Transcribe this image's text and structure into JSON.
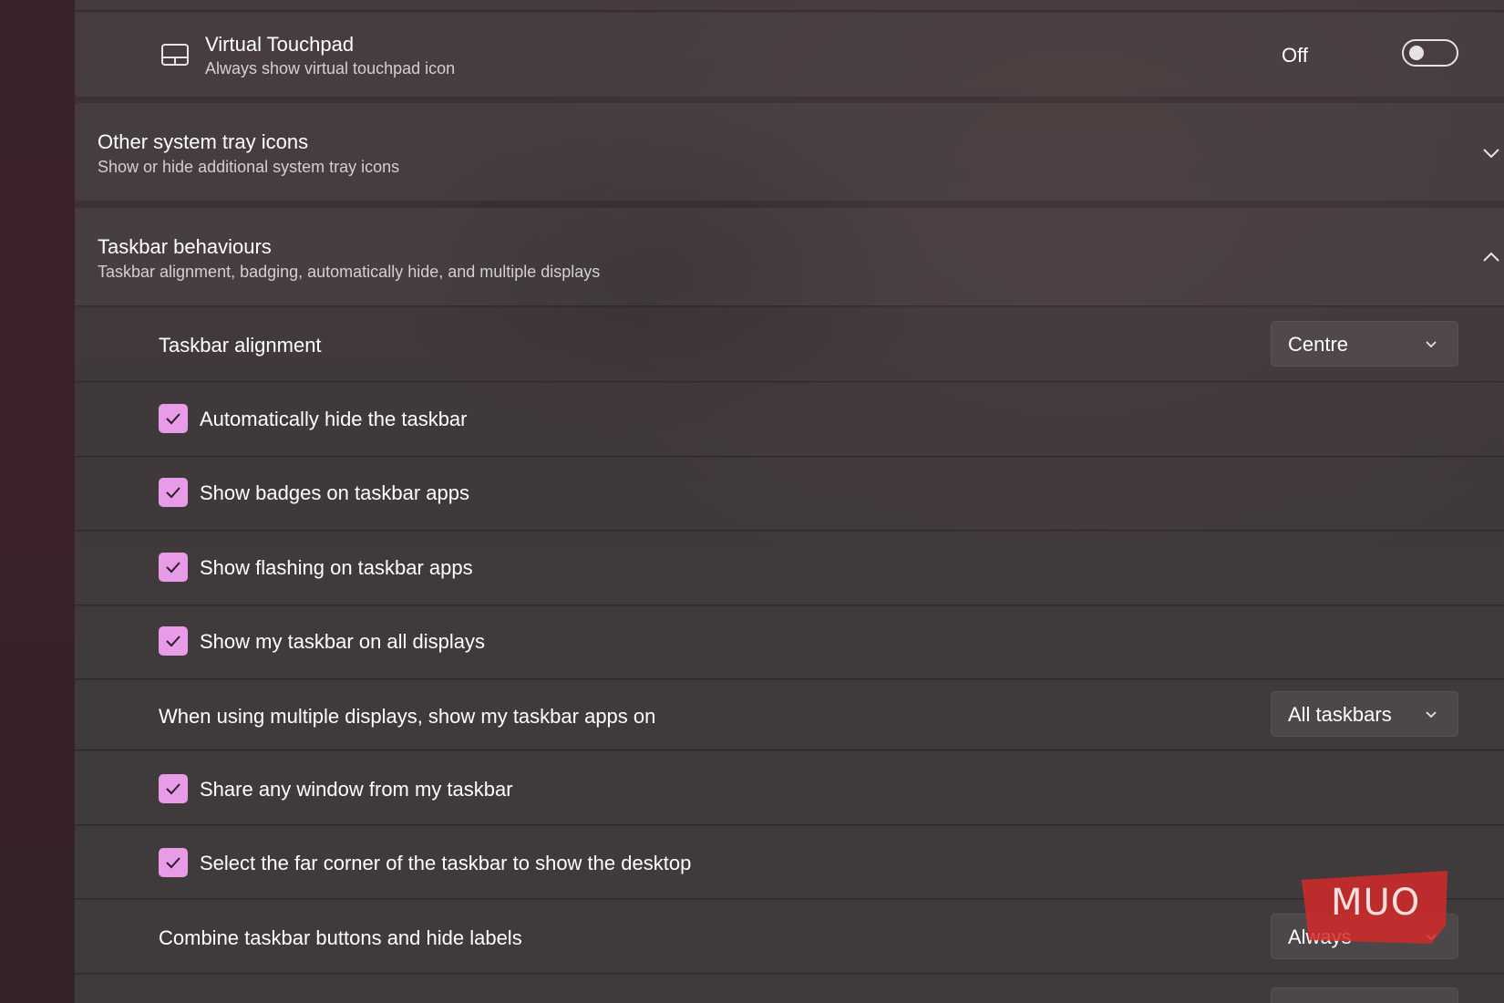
{
  "virtual_touchpad": {
    "icon": "touchpad-icon",
    "title": "Virtual Touchpad",
    "description": "Always show virtual touchpad icon",
    "toggle_state": "Off",
    "toggle_on": false
  },
  "other_tray_icons": {
    "title": "Other system tray icons",
    "description": "Show or hide additional system tray icons",
    "expanded": false
  },
  "taskbar_behaviours": {
    "title": "Taskbar behaviours",
    "description": "Taskbar alignment, badging, automatically hide, and multiple displays",
    "expanded": true,
    "alignment": {
      "label": "Taskbar alignment",
      "value": "Centre"
    },
    "options": [
      {
        "label": "Automatically hide the taskbar",
        "checked": true
      },
      {
        "label": "Show badges on taskbar apps",
        "checked": true
      },
      {
        "label": "Show flashing on taskbar apps",
        "checked": true
      },
      {
        "label": "Show my taskbar on all displays",
        "checked": true
      }
    ],
    "multiple_displays": {
      "label": "When using multiple displays, show my taskbar apps on",
      "value": "All taskbars"
    },
    "options2": [
      {
        "label": "Share any window from my taskbar",
        "checked": true
      },
      {
        "label": "Select the far corner of the taskbar to show the desktop",
        "checked": true
      }
    ],
    "combine": {
      "label": "Combine taskbar buttons and hide labels",
      "value": "Always"
    }
  },
  "watermark": {
    "text": "MUO"
  },
  "colors": {
    "accent": "#e89be6",
    "watermark": "#d42a2a"
  }
}
